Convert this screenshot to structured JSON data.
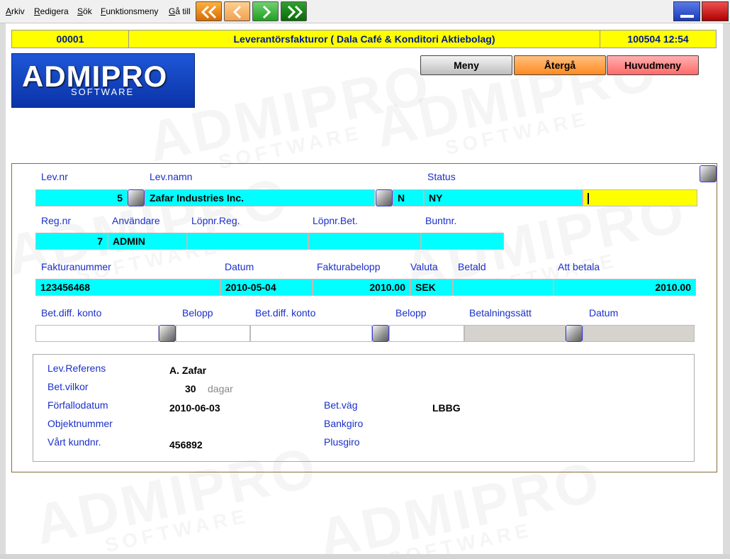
{
  "menu": {
    "items": [
      {
        "u": "A",
        "rest": "rkiv"
      },
      {
        "u": "R",
        "rest": "edigera"
      },
      {
        "u": "S",
        "rest": "ök"
      },
      {
        "u": "F",
        "rest": "unktionsmeny"
      },
      {
        "u": "G",
        "rest": "å till"
      }
    ]
  },
  "header": {
    "id": "00001",
    "title": "Leverantörsfakturor ( Dala Café & Konditori Aktiebolag)",
    "datetime": "100504 12:54"
  },
  "logo": {
    "main": "ADMIPRO",
    "sub": "SOFTWARE"
  },
  "buttons": {
    "meny": "Meny",
    "atergå": "Återgå",
    "huvudmeny": "Huvudmeny"
  },
  "colors": {
    "meny": "#d0d0d0",
    "atergå": "#ffa040",
    "huvudmeny": "#ff8080"
  },
  "row1": {
    "labels": {
      "levnr": "Lev.nr",
      "levnamn": "Lev.namn",
      "status": "Status"
    },
    "levnr": "5",
    "levnamn": "Zafar Industries Inc.",
    "flag": "N",
    "status": "NY"
  },
  "row2": {
    "labels": {
      "regnr": "Reg.nr",
      "anvandare": "Användare",
      "lopnrreg": "Löpnr.Reg.",
      "lopnrbet": "Löpnr.Bet.",
      "buntnr": "Buntnr."
    },
    "regnr": "7",
    "anvandare": "ADMIN"
  },
  "row3": {
    "labels": {
      "fakturanr": "Fakturanummer",
      "datum": "Datum",
      "belopp": "Fakturabelopp",
      "valuta": "Valuta",
      "betald": "Betald",
      "attbetala": "Att betala"
    },
    "fakturanr": "123456468",
    "datum": "2010-05-04",
    "belopp": "2010.00",
    "valuta": "SEK",
    "attbetala": "2010.00"
  },
  "row4": {
    "labels": {
      "konto1": "Bet.diff. konto",
      "belopp1": "Belopp",
      "konto2": "Bet.diff. konto",
      "belopp2": "Belopp",
      "betsatt": "Betalningssätt",
      "datum": "Datum"
    }
  },
  "details": {
    "labels": {
      "levref": "Lev.Referens",
      "betvilkor": "Bet.vilkor",
      "forfallo": "Förfallodatum",
      "objekt": "Objektnummer",
      "kundnr": "Vårt kundnr.",
      "betvag": "Bet.väg",
      "bankgiro": "Bankgiro",
      "plusgiro": "Plusgiro",
      "dagar": "dagar"
    },
    "levref": "A. Zafar",
    "betvilkor": "30",
    "forfallo": "2010-06-03",
    "kundnr": "456892",
    "betvag": "LBBG"
  }
}
